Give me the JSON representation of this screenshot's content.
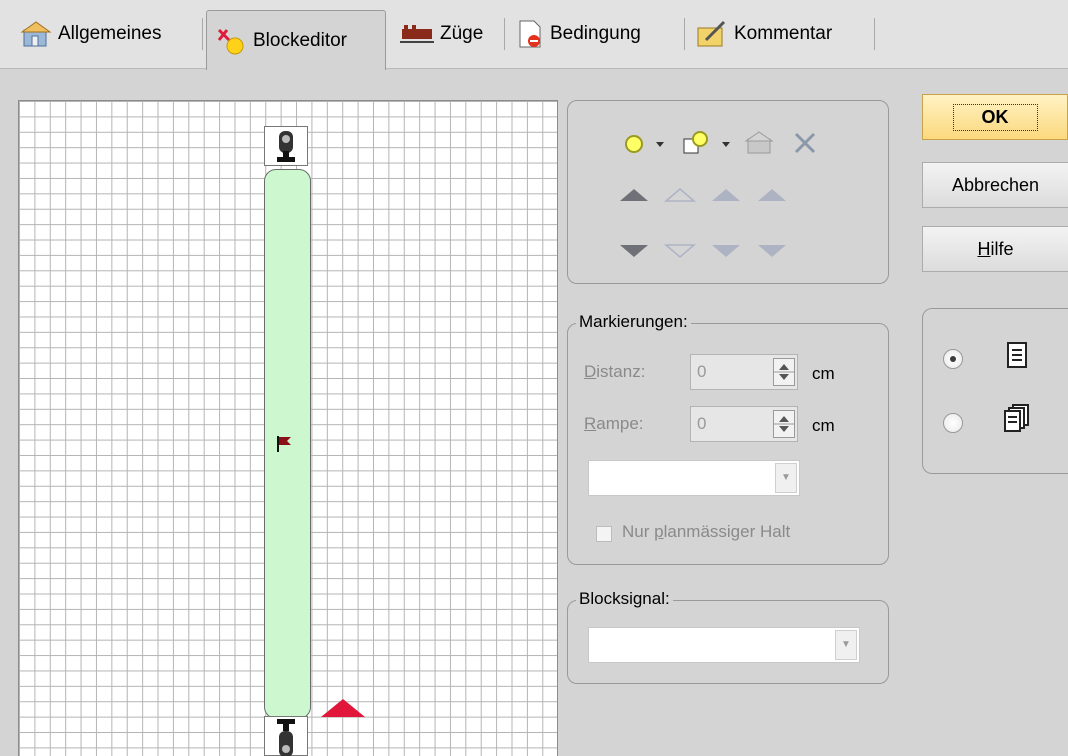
{
  "tabs": [
    {
      "label": "Allgemeines",
      "icon": "general-properties-icon"
    },
    {
      "label": "Blockeditor",
      "icon": "block-editor-icon",
      "active": true
    },
    {
      "label": "Züge",
      "icon": "trains-icon"
    },
    {
      "label": "Bedingung",
      "icon": "condition-icon"
    },
    {
      "label": "Kommentar",
      "icon": "comment-icon"
    }
  ],
  "markierungen": {
    "legend": "Markierungen:",
    "distanz_label": "Distanz:",
    "distanz_value": "0",
    "distanz_unit": "cm",
    "rampe_label": "Rampe:",
    "rampe_value": "0",
    "rampe_unit": "cm",
    "nur_halt_label": "Nur planmässiger Halt",
    "nur_halt_checked": false
  },
  "blocksignal": {
    "legend": "Blocksignal:",
    "value": ""
  },
  "buttons": {
    "ok": "OK",
    "abbrechen": "Abbrechen",
    "hilfe": "Hilfe"
  },
  "view_mode": {
    "options": [
      "single-page-icon",
      "multi-page-icon"
    ],
    "selected": 0
  },
  "colors": {
    "block_fill": "#ccf7cf",
    "marker_red": "#e0163a",
    "ok_gold": "#fbd97e"
  }
}
